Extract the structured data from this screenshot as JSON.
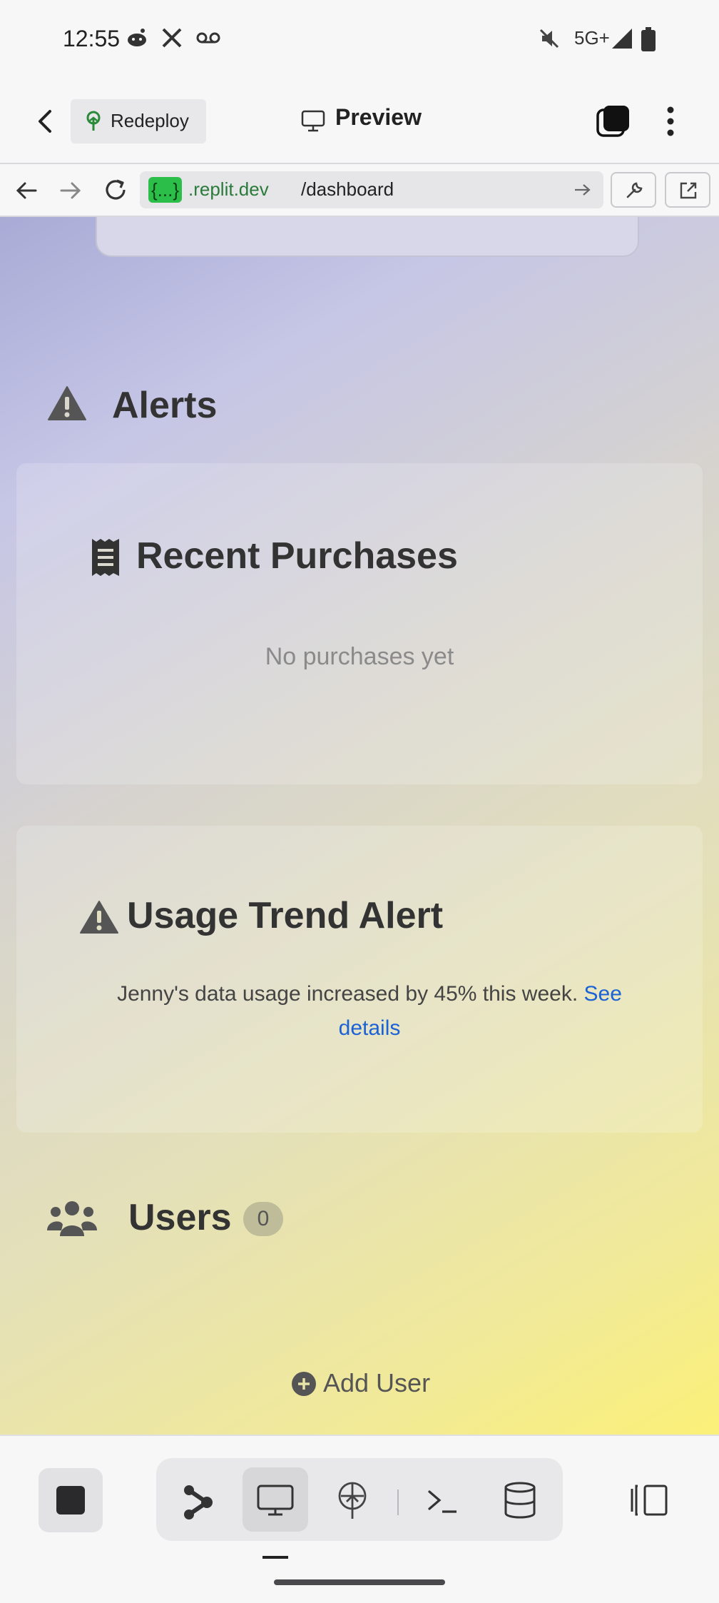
{
  "status_bar": {
    "time": "12:55",
    "network": "5G+",
    "icons": [
      "reddit-icon",
      "x-icon",
      "voicemail-icon",
      "mute-icon",
      "signal-icon",
      "battery-icon"
    ]
  },
  "app_header": {
    "redeploy_label": "Redeploy",
    "preview_label": "Preview"
  },
  "browser": {
    "url_host": "{...}",
    "url_domain": ".replit.dev",
    "url_path": "/dashboard"
  },
  "page": {
    "alerts_title": "Alerts",
    "purchases_title": "Recent Purchases",
    "purchases_empty": "No purchases yet",
    "trend_title": "Usage Trend Alert",
    "trend_text": "Jenny's data usage increased by 45% this week.",
    "trend_link": "See details",
    "users_title": "Users",
    "users_count": "0",
    "add_user_label": "Add User"
  },
  "colors": {
    "accent_link": "#1a62d6",
    "url_host_bg": "#2bbf4a",
    "gradient_start": "#a9abd6",
    "gradient_end": "#fbf078"
  }
}
